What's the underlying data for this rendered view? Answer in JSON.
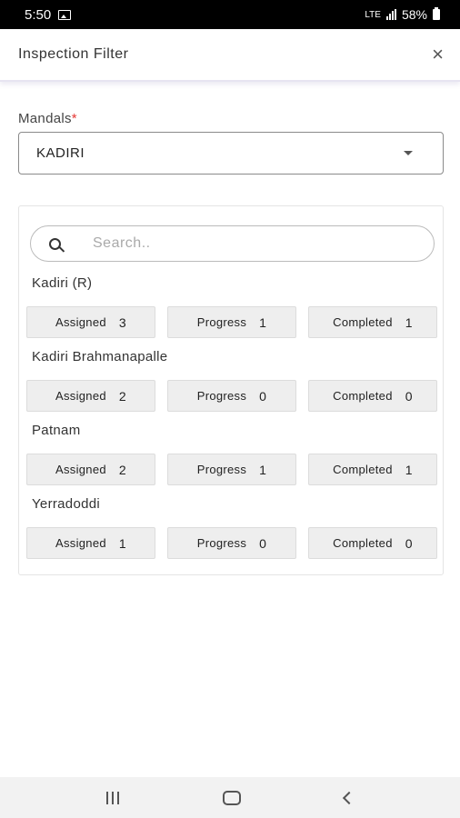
{
  "status_bar": {
    "time": "5:50",
    "battery": "58%",
    "network": "LTE"
  },
  "header": {
    "title": "Inspection Filter",
    "close_glyph": "×"
  },
  "filter": {
    "mandals_label": "Mandals",
    "required_mark": "*",
    "selected_mandal": "KADIRI"
  },
  "search": {
    "placeholder": "Search.."
  },
  "villages": [
    {
      "name": "Kadiri (R)",
      "assigned_label": "Assigned",
      "assigned": "3",
      "progress_label": "Progress",
      "progress": "1",
      "completed_label": "Completed",
      "completed": "1"
    },
    {
      "name": "Kadiri Brahmanapalle",
      "assigned_label": "Assigned",
      "assigned": "2",
      "progress_label": "Progress",
      "progress": "0",
      "completed_label": "Completed",
      "completed": "0"
    },
    {
      "name": "Patnam",
      "assigned_label": "Assigned",
      "assigned": "2",
      "progress_label": "Progress",
      "progress": "1",
      "completed_label": "Completed",
      "completed": "1"
    },
    {
      "name": "Yerradoddi",
      "assigned_label": "Assigned",
      "assigned": "1",
      "progress_label": "Progress",
      "progress": "0",
      "completed_label": "Completed",
      "completed": "0"
    }
  ]
}
